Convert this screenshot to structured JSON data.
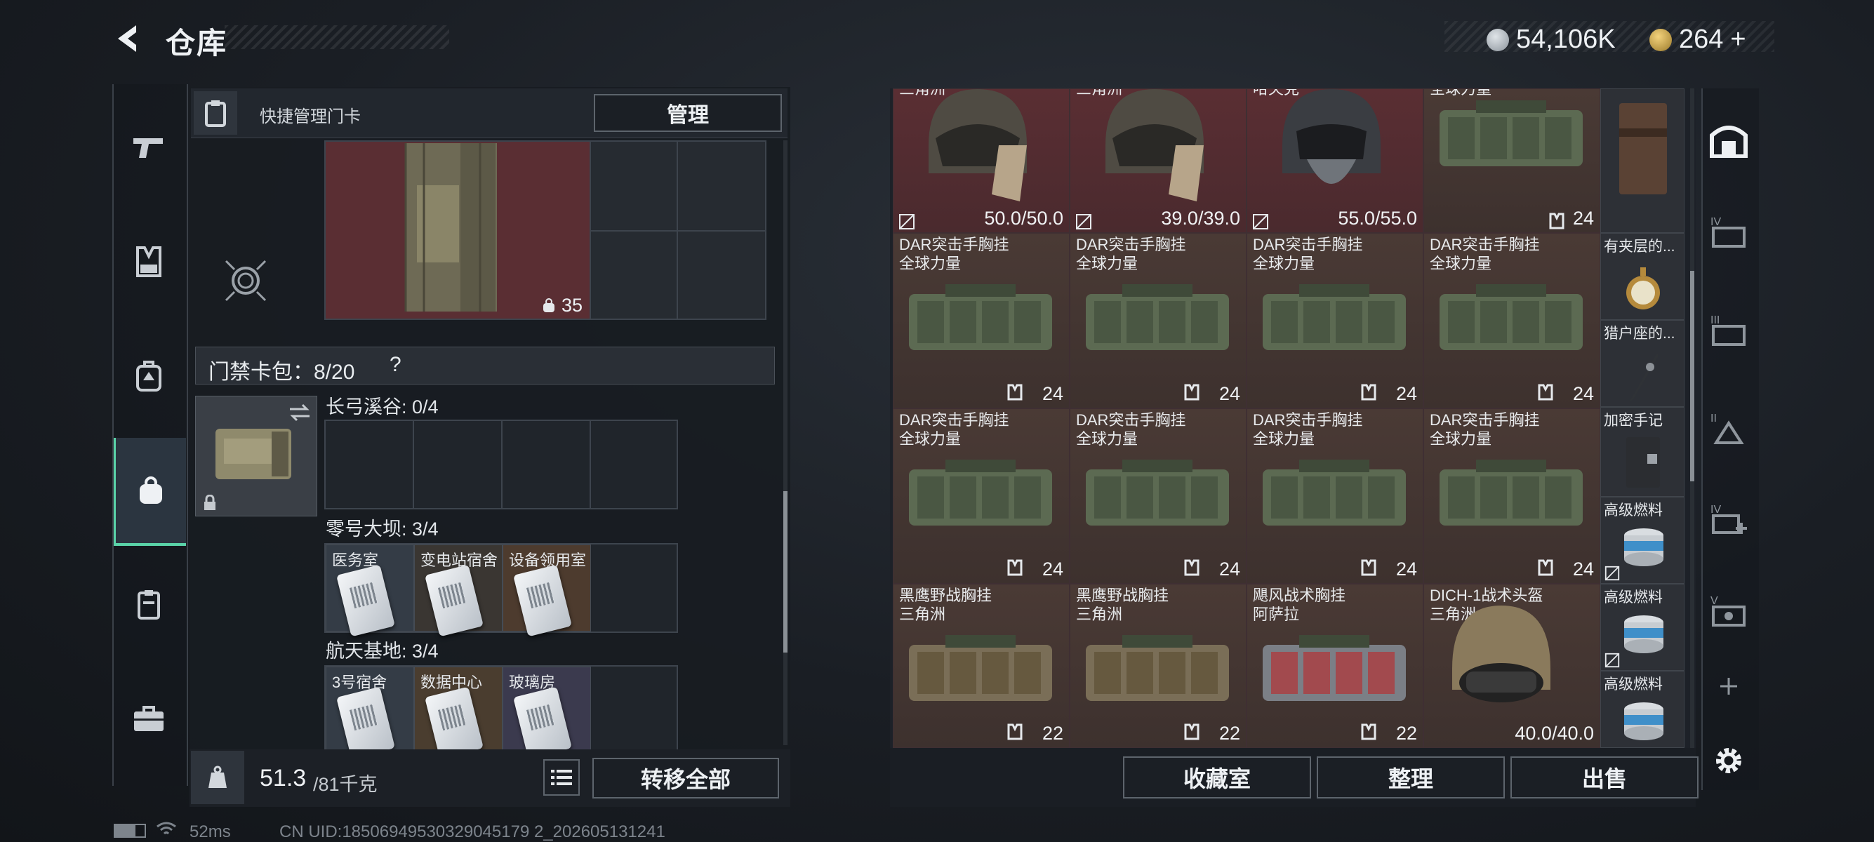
{
  "header": {
    "title": "仓库",
    "coins": "54,106K",
    "tokens": "264",
    "tokens_plus": "+"
  },
  "left_nav": {
    "items": [
      "pistol-icon",
      "armor-vest-icon",
      "backpack-icon",
      "keycard-bag-icon",
      "card-holder-icon",
      "toolbox-icon"
    ],
    "active_index": 3
  },
  "keycard_panel": {
    "quick_manage_label": "快捷管理门卡",
    "manage_button": "管理",
    "backpack_capacity": "35",
    "bag_label": "门禁卡包：8/20",
    "help": "?",
    "maps": [
      {
        "title": "长弓溪谷: 0/4",
        "cards": []
      },
      {
        "title": "零号大坝: 3/4",
        "cards": [
          "医务室",
          "变电站宿舍",
          "设备领用室"
        ]
      },
      {
        "title": "航天基地: 3/4",
        "cards": [
          "3号宿舍",
          "数据中心",
          "玻璃房"
        ]
      }
    ]
  },
  "weight": {
    "current": "51.3",
    "max": "/81千克"
  },
  "transfer_all_button": "转移全部",
  "inventory": {
    "row0": [
      {
        "name": "三角洲",
        "value": "50.0/50.0"
      },
      {
        "name": "三角洲",
        "value": "39.0/39.0"
      },
      {
        "name": "哈夫克",
        "value": "55.0/55.0"
      },
      {
        "name": "全球力量",
        "value": "24"
      }
    ],
    "rows": [
      [
        {
          "name": "DAR突击手胸挂\n全球力量",
          "value": "24"
        },
        {
          "name": "DAR突击手胸挂\n全球力量",
          "value": "24"
        },
        {
          "name": "DAR突击手胸挂\n全球力量",
          "value": "24"
        },
        {
          "name": "DAR突击手胸挂\n全球力量",
          "value": "24"
        }
      ],
      [
        {
          "name": "DAR突击手胸挂\n全球力量",
          "value": "24"
        },
        {
          "name": "DAR突击手胸挂\n全球力量",
          "value": "24"
        },
        {
          "name": "DAR突击手胸挂\n全球力量",
          "value": "24"
        },
        {
          "name": "DAR突击手胸挂\n全球力量",
          "value": "24"
        }
      ],
      [
        {
          "name": "黑鹰野战胸挂\n三角洲",
          "value": "22"
        },
        {
          "name": "黑鹰野战胸挂\n三角洲",
          "value": "22"
        },
        {
          "name": "飓风战术胸挂\n阿萨拉",
          "value": "22"
        },
        {
          "name": "DICH-1战术头盔\n三角洲",
          "value": "40.0/40.0"
        }
      ]
    ],
    "side_column": [
      "有夹层的...",
      "猎户座的...",
      "加密手记",
      "高级燃料",
      "高级燃料",
      "高级燃料"
    ]
  },
  "bottom_buttons": {
    "collection": "收藏室",
    "sort": "整理",
    "sell": "出售"
  },
  "right_nav": [
    "safe-box-icon",
    "storage-IV-icon",
    "storage-III-icon",
    "storage-II-icon",
    "storage-IV-add-icon",
    "storage-V-icon",
    "add-storage-icon"
  ],
  "footer": {
    "ping": "52ms",
    "uid": "CN UID:18506949530329045179 2_202605131241"
  },
  "colors": {
    "accent": "#5ad3a8",
    "red_slot": "#5a2e33",
    "brown_slot": "#4a3a35"
  }
}
